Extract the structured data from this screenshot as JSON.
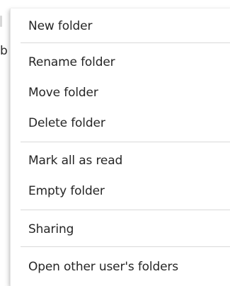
{
  "background": {
    "partial_text": "b"
  },
  "menu": {
    "groups": [
      {
        "items": [
          {
            "label": "New folder"
          }
        ]
      },
      {
        "items": [
          {
            "label": "Rename folder"
          },
          {
            "label": "Move folder"
          },
          {
            "label": "Delete folder"
          }
        ]
      },
      {
        "items": [
          {
            "label": "Mark all as read"
          },
          {
            "label": "Empty folder"
          }
        ]
      },
      {
        "items": [
          {
            "label": "Sharing"
          }
        ]
      },
      {
        "items": [
          {
            "label": "Open other user's folders"
          }
        ]
      }
    ]
  },
  "colors": {
    "menu_background": "#ffffff",
    "text": "#262626",
    "divider": "#d9d9d9"
  }
}
